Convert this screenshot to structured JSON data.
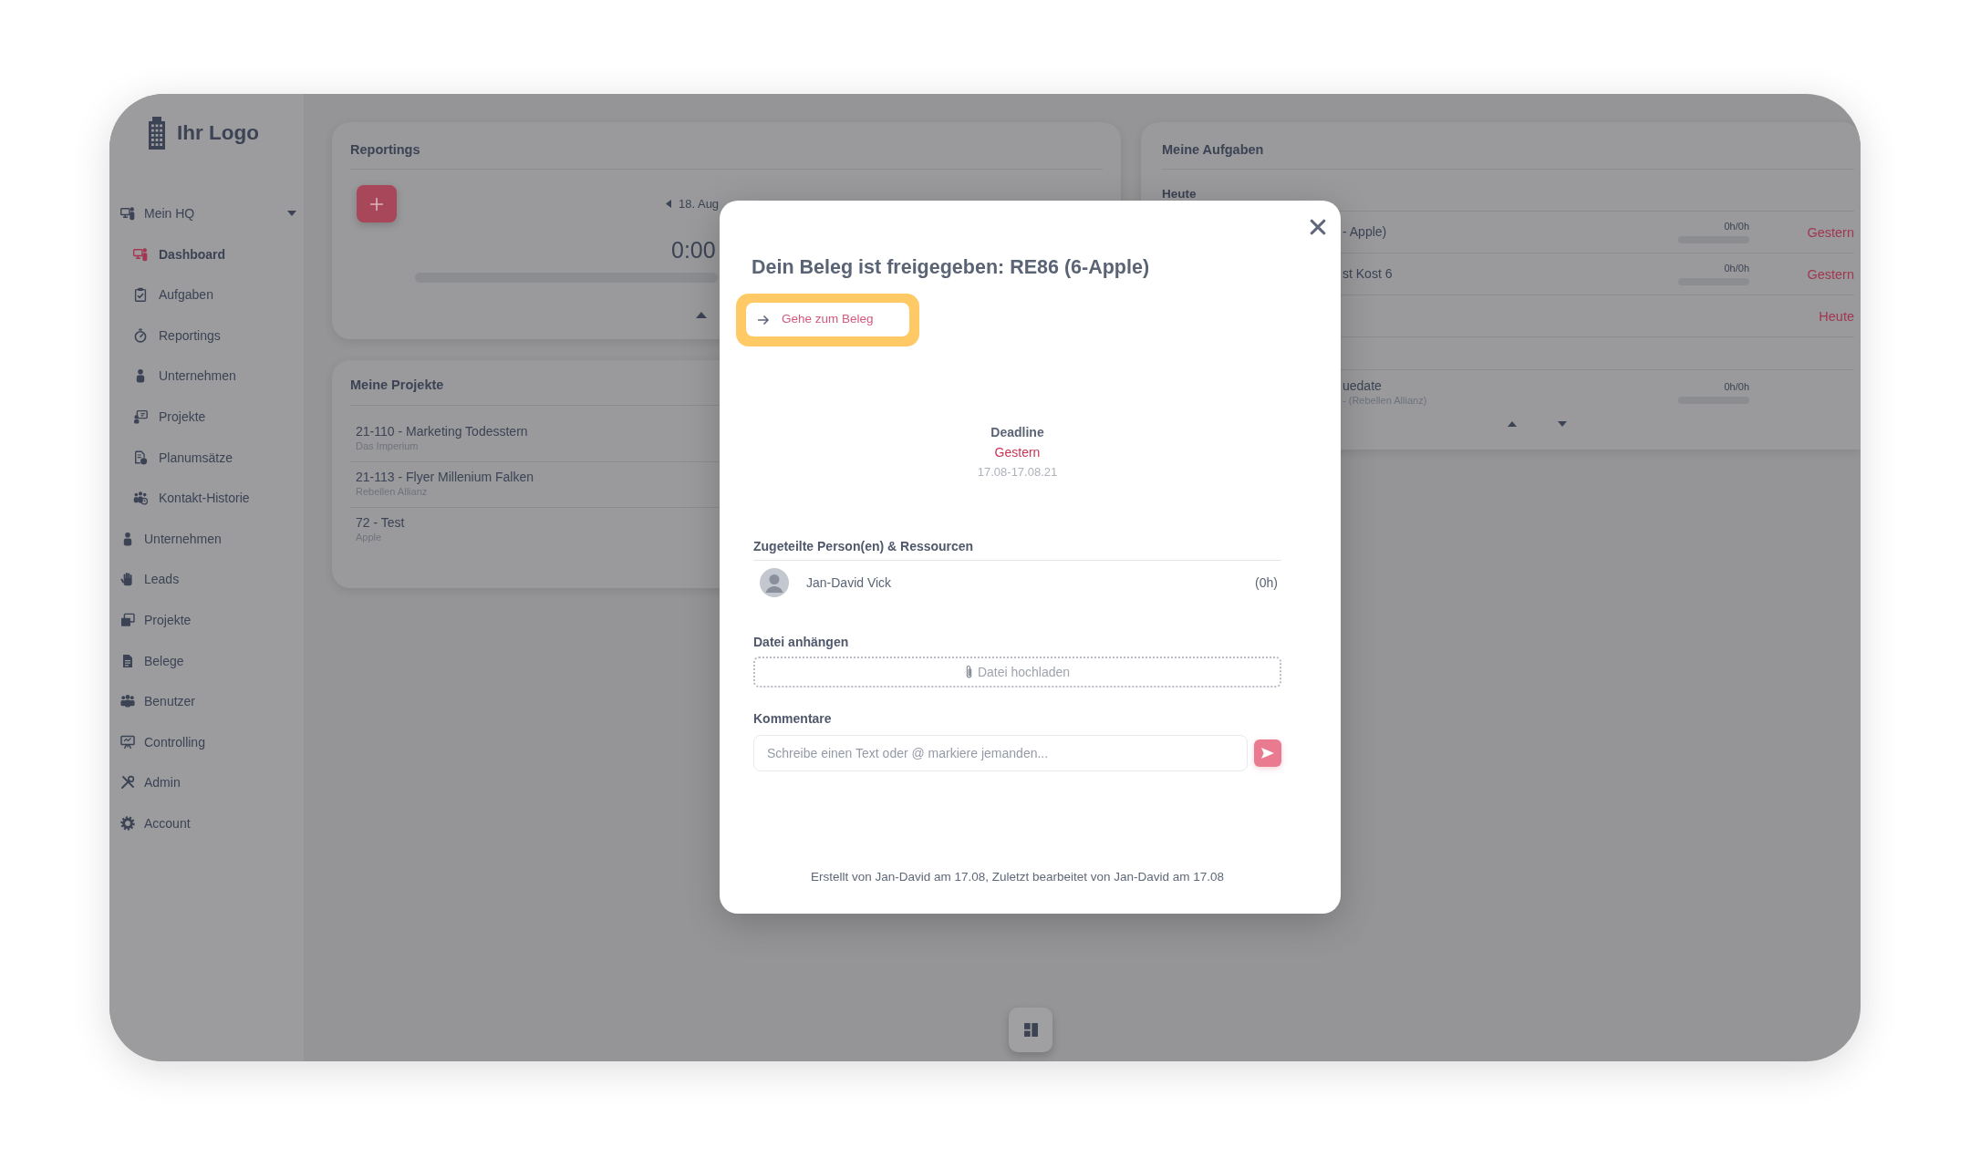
{
  "sidebar": {
    "logo": "Ihr Logo",
    "items": [
      {
        "label": "Mein HQ",
        "expanded": true,
        "selected": false,
        "children": [
          {
            "label": "Dashboard",
            "selected": true
          },
          {
            "label": "Aufgaben",
            "selected": false
          },
          {
            "label": "Reportings",
            "selected": false
          },
          {
            "label": "Unternehmen",
            "selected": false
          },
          {
            "label": "Projekte",
            "selected": false
          },
          {
            "label": "Planumsätze",
            "selected": false
          },
          {
            "label": "Kontakt-Historie",
            "selected": false
          }
        ]
      },
      {
        "label": "Unternehmen",
        "expanded": false,
        "selected": false
      },
      {
        "label": "Leads",
        "expanded": false,
        "selected": false
      },
      {
        "label": "Projekte",
        "expanded": false,
        "selected": false
      },
      {
        "label": "Belege",
        "expanded": false,
        "selected": false
      },
      {
        "label": "Benutzer",
        "expanded": false,
        "selected": false
      },
      {
        "label": "Controlling",
        "expanded": false,
        "selected": false
      },
      {
        "label": "Admin",
        "expanded": false,
        "selected": false
      },
      {
        "label": "Account",
        "expanded": false,
        "selected": false
      }
    ]
  },
  "reportings": {
    "title": "Reportings",
    "date": "18. Aug",
    "time": "0:00"
  },
  "projects": {
    "title": "Meine Projekte",
    "items": [
      {
        "title": "21-110 - Marketing Todesstern",
        "client": "Das Imperium"
      },
      {
        "title": "21-113 - Flyer Millenium Falken",
        "client": "Rebellen Allianz"
      },
      {
        "title": "72 - Test",
        "client": "Apple"
      }
    ]
  },
  "tasks": {
    "title": "Meine Aufgaben",
    "groups": [
      {
        "heading": "Heute",
        "rows": [
          {
            "title": "- Apple)",
            "hours": "0h/0h",
            "due": "Gestern"
          },
          {
            "title": "st Kost 6",
            "hours": "0h/0h",
            "due": "Gestern"
          },
          {
            "due": "Heute"
          }
        ]
      },
      {
        "rows": [
          {
            "title": "uedate",
            "subtitle": "- (Rebellen Allianz)",
            "hours": "0h/0h"
          }
        ]
      }
    ]
  },
  "modal": {
    "title": "Dein Beleg ist freigegeben: RE86 (6-Apple)",
    "link": {
      "label": "Gehe zum Beleg",
      "highlighted": true
    },
    "deadline": {
      "label": "Deadline",
      "value": "Gestern",
      "range": "17.08-17.08.21"
    },
    "assignees": {
      "heading": "Zugeteilte Person(en) & Ressourcen",
      "people": [
        {
          "name": "Jan-David Vick",
          "hours": "(0h)"
        }
      ]
    },
    "attachment": {
      "heading": "Datei anhängen",
      "upload": "Datei hochladen"
    },
    "comments": {
      "heading": "Kommentare",
      "placeholder": "Schreibe einen Text oder @ markiere jemanden..."
    },
    "footer": "Erstellt von Jan-David am 17.08, Zuletzt bearbeitet von Jan-David am 17.08"
  }
}
